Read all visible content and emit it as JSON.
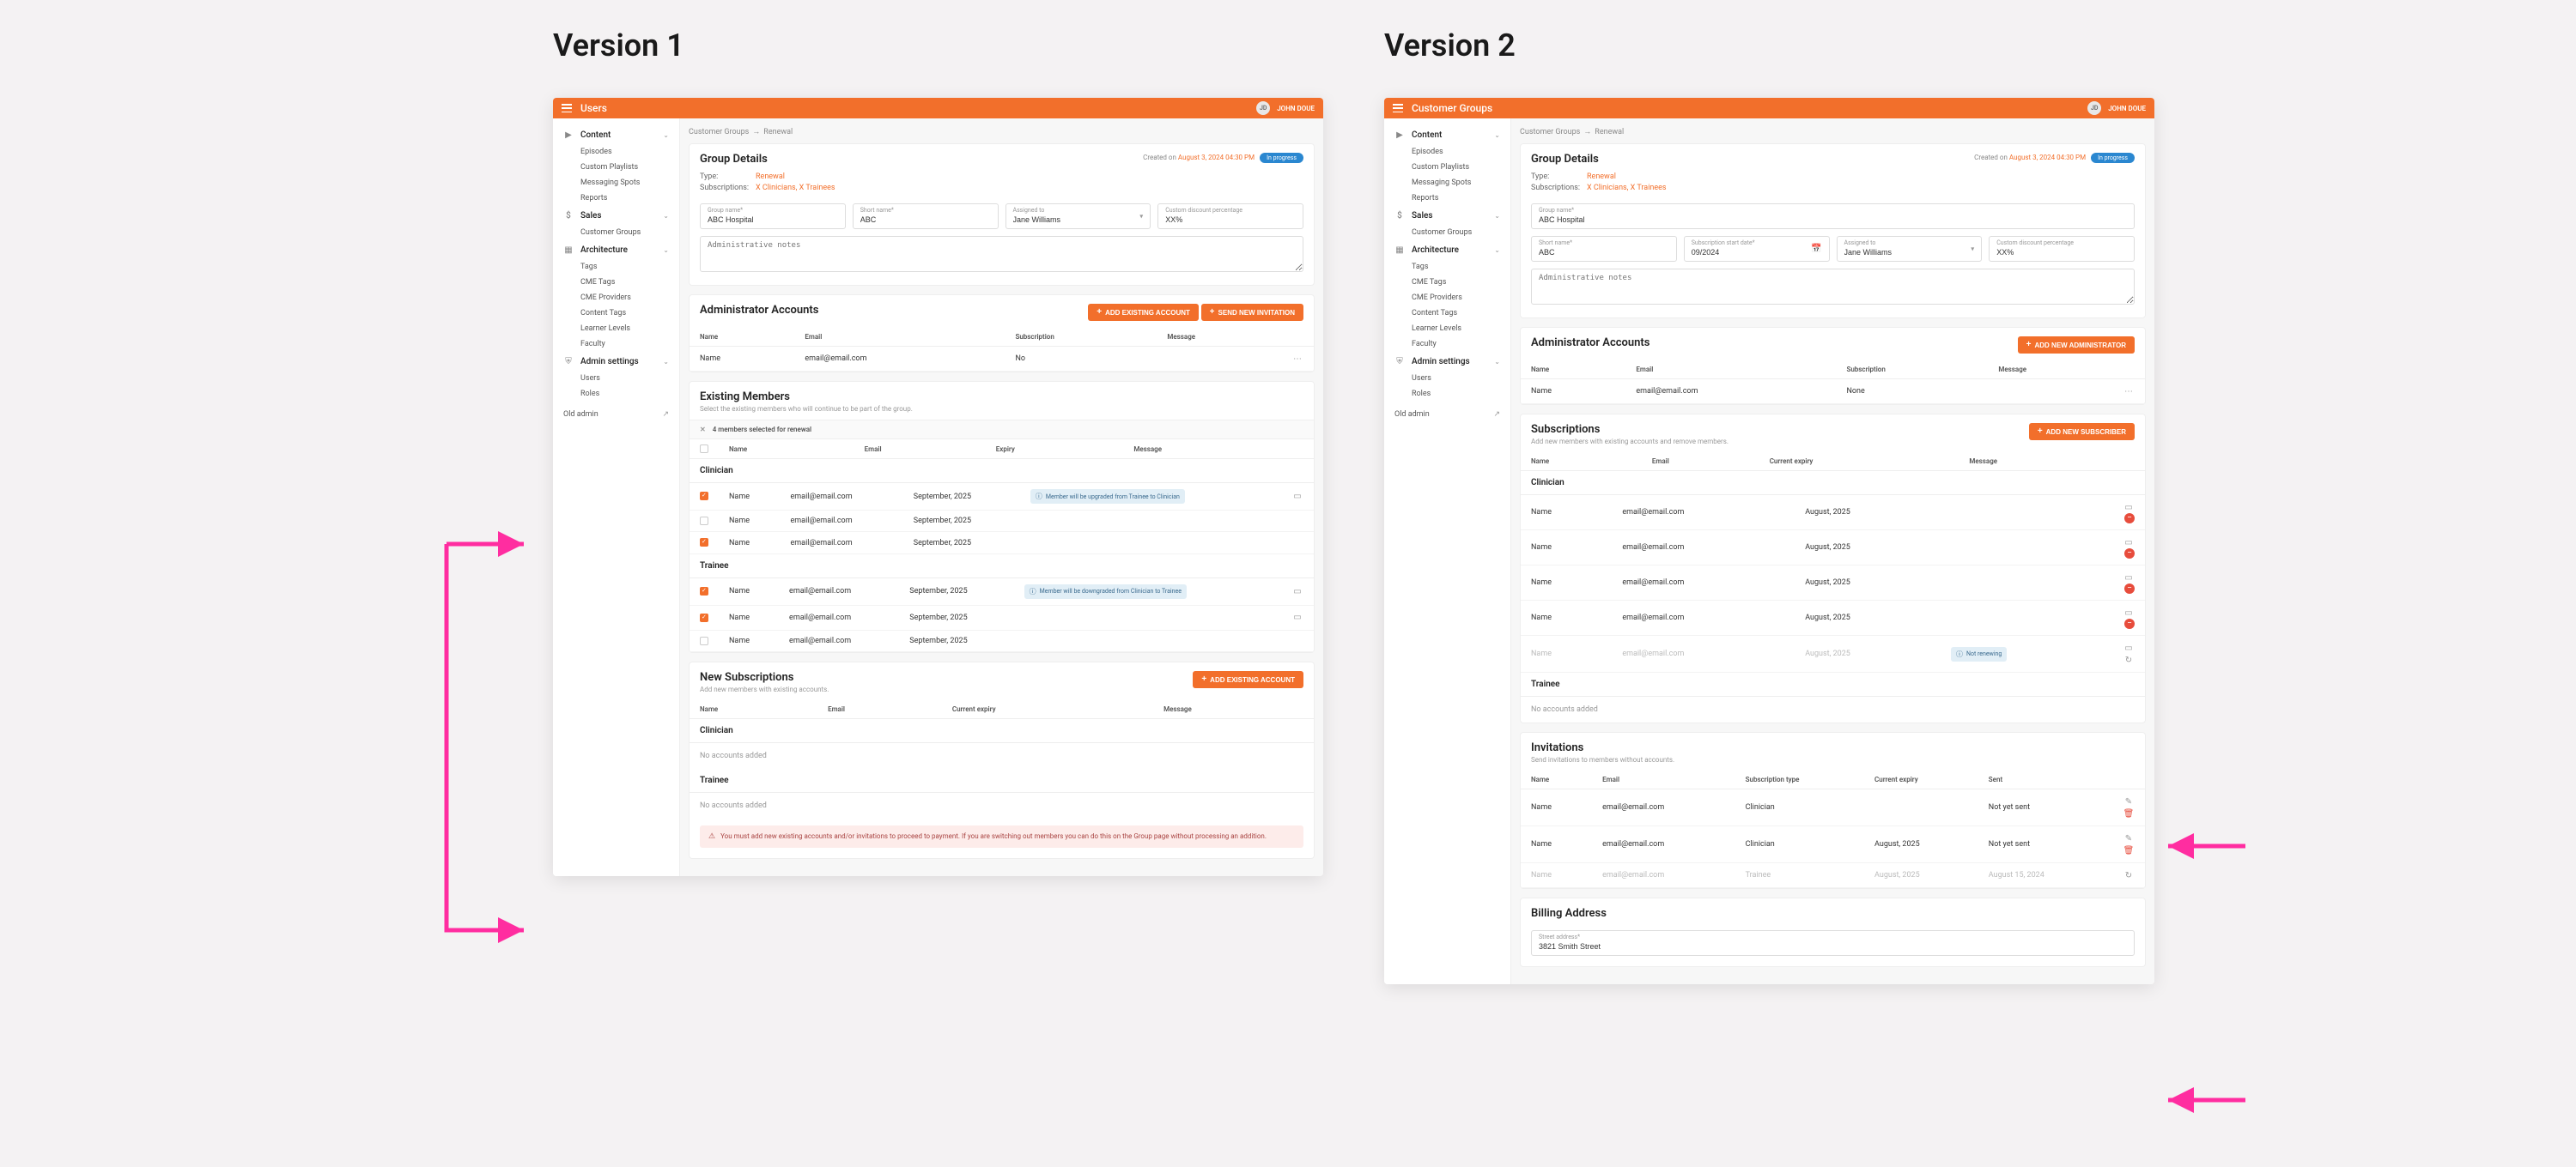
{
  "labels": {
    "v1": "Version 1",
    "v2": "Version 2"
  },
  "common": {
    "user_initials": "JD",
    "user_name": "JOHN DOUE",
    "nav": {
      "content": {
        "label": "Content",
        "items": [
          "Episodes",
          "Custom Playlists",
          "Messaging Spots",
          "Reports"
        ]
      },
      "sales": {
        "label": "Sales",
        "items": [
          "Customer Groups"
        ]
      },
      "arch": {
        "label": "Architecture",
        "items": [
          "Tags",
          "CME Tags",
          "CME Providers",
          "Content Tags",
          "Learner Levels",
          "Faculty"
        ]
      },
      "admin": {
        "label": "Admin settings",
        "items": [
          "Users",
          "Roles"
        ]
      },
      "old_admin": "Old admin"
    },
    "breadcrumb": {
      "root": "Customer Groups",
      "leaf": "Renewal"
    },
    "group_details": {
      "title": "Group Details",
      "created_label": "Created on",
      "created_date": "August 3, 2024 04:30 PM",
      "status": "In progress",
      "type_label": "Type:",
      "type_val": "Renewal",
      "subs_label": "Subscriptions:",
      "subs_val": "X Clinicians, X Trainees",
      "group_name_label": "Group name*",
      "group_name": "ABC Hospital",
      "short_name_label": "Short name*",
      "short_name": "ABC",
      "assigned_label": "Assigned to",
      "assigned": "Jane Williams",
      "discount_label": "Custom discount percentage",
      "discount": "XX%",
      "start_label": "Subscription start date*",
      "start": "09/2024",
      "notes_ph": "Administrative notes"
    },
    "tables": {
      "name": "Name",
      "email": "Email",
      "sub": "Subscription",
      "msg": "Message",
      "expiry": "Expiry",
      "cur_expiry": "Current expiry",
      "sub_type": "Subscription type",
      "sent": "Sent"
    },
    "vals": {
      "name": "Name",
      "email": "email@email.com",
      "none": "None",
      "no": "No",
      "sep25": "September, 2025",
      "aug25": "August, 2025",
      "aug24": "August 15, 2024",
      "clin": "Clinician",
      "tra": "Trainee",
      "notyet": "Not yet sent",
      "notren": "Not renewing",
      "noacc": "No accounts added"
    }
  },
  "v1": {
    "title": "Users",
    "admin": {
      "title": "Administrator Accounts",
      "btn_existing": "ADD EXISTING ACCOUNT",
      "btn_invite": "SEND NEW INVITATION"
    },
    "existing": {
      "title": "Existing Members",
      "sub": "Select the existing members who will continue to be part of the group.",
      "badge": "4 members selected for renewal",
      "sec_clin": "Clinician",
      "sec_tra": "Trainee",
      "upgrade": "Member will be upgraded from Trainee to Clinician",
      "downgrade": "Member will be downgraded from Clinician to Trainee"
    },
    "newsubs": {
      "title": "New Subscriptions",
      "sub": "Add new members with existing accounts.",
      "btn": "ADD EXISTING ACCOUNT",
      "warning": "You must add new existing accounts and/or invitations to proceed to payment. If you are switching out members you can do this on the Group page without processing an addition."
    }
  },
  "v2": {
    "title": "Customer Groups",
    "admin": {
      "title": "Administrator Accounts",
      "btn": "ADD NEW ADMINISTRATOR"
    },
    "subs": {
      "title": "Subscriptions",
      "sub": "Add new members with existing accounts and remove members.",
      "btn": "ADD NEW SUBSCRIBER",
      "sec_clin": "Clinician",
      "sec_tra": "Trainee"
    },
    "inv": {
      "title": "Invitations",
      "sub": "Send invitations to members without accounts."
    },
    "billing": {
      "title": "Billing Address",
      "street_label": "Street address*",
      "street": "3821 Smith Street"
    }
  }
}
